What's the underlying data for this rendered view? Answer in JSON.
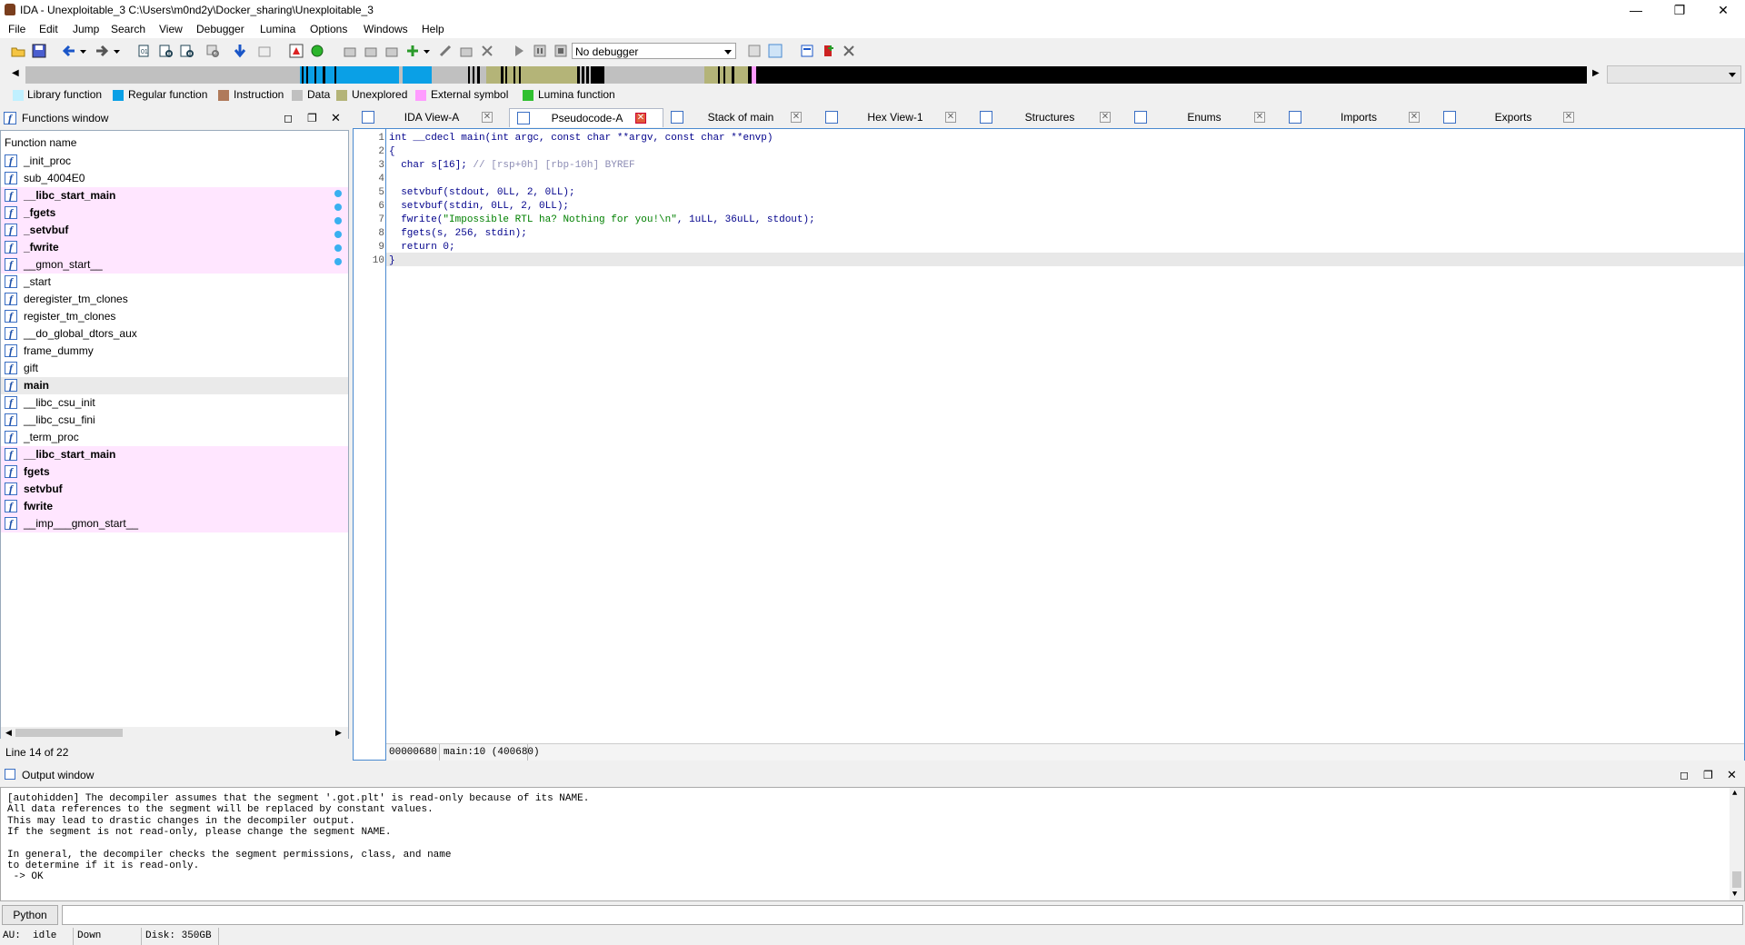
{
  "title_bar": {
    "title": "IDA - Unexploitable_3 C:\\Users\\m0nd2y\\Docker_sharing\\Unexploitable_3",
    "minimize": "—",
    "restore": "❐",
    "close": "✕"
  },
  "menu": [
    "File",
    "Edit",
    "Jump",
    "Search",
    "View",
    "Debugger",
    "Lumina",
    "Options",
    "Windows",
    "Help"
  ],
  "toolbar": {
    "debugger_select": "No debugger"
  },
  "legend": [
    {
      "label": "Library function",
      "color": "#c0f0ff"
    },
    {
      "label": "Regular function",
      "color": "#0aa0e6"
    },
    {
      "label": "Instruction",
      "color": "#b07a5a"
    },
    {
      "label": "Data",
      "color": "#c0c0c0"
    },
    {
      "label": "Unexplored",
      "color": "#b4b478"
    },
    {
      "label": "External symbol",
      "color": "#ff9cff"
    },
    {
      "label": "Lumina function",
      "color": "#30c030"
    }
  ],
  "functions_window": {
    "title": "Functions window",
    "column_header": "Function name",
    "status": "Line 14 of 22",
    "items": [
      {
        "name": "_init_proc",
        "style": "normal"
      },
      {
        "name": "sub_4004E0",
        "style": "normal"
      },
      {
        "name": "__libc_start_main",
        "style": "pink-bold"
      },
      {
        "name": "_fgets",
        "style": "pink-bold"
      },
      {
        "name": "_setvbuf",
        "style": "pink-bold"
      },
      {
        "name": "_fwrite",
        "style": "pink-bold"
      },
      {
        "name": "__gmon_start__",
        "style": "pink"
      },
      {
        "name": "_start",
        "style": "normal"
      },
      {
        "name": "deregister_tm_clones",
        "style": "normal"
      },
      {
        "name": "register_tm_clones",
        "style": "normal"
      },
      {
        "name": "__do_global_dtors_aux",
        "style": "normal"
      },
      {
        "name": "frame_dummy",
        "style": "normal"
      },
      {
        "name": "gift",
        "style": "normal"
      },
      {
        "name": "main",
        "style": "selected-bold"
      },
      {
        "name": "__libc_csu_init",
        "style": "normal"
      },
      {
        "name": "__libc_csu_fini",
        "style": "normal"
      },
      {
        "name": "_term_proc",
        "style": "normal"
      },
      {
        "name": "__libc_start_main",
        "style": "pink-bold"
      },
      {
        "name": "fgets",
        "style": "pink-bold"
      },
      {
        "name": "setvbuf",
        "style": "pink-bold"
      },
      {
        "name": "fwrite",
        "style": "pink-bold"
      },
      {
        "name": "__imp___gmon_start__",
        "style": "pink"
      }
    ]
  },
  "tabs": [
    {
      "label": "IDA View-A",
      "icon": "ida-view-icon",
      "active": false
    },
    {
      "label": "Pseudocode-A",
      "icon": "pseudocode-icon",
      "active": true
    },
    {
      "label": "Stack of main",
      "icon": "stack-icon",
      "active": false
    },
    {
      "label": "Hex View-1",
      "icon": "hex-view-icon",
      "active": false
    },
    {
      "label": "Structures",
      "icon": "structures-icon",
      "active": false
    },
    {
      "label": "Enums",
      "icon": "enums-icon",
      "active": false
    },
    {
      "label": "Imports",
      "icon": "imports-icon",
      "active": false
    },
    {
      "label": "Exports",
      "icon": "exports-icon",
      "active": false
    }
  ],
  "pseudocode": {
    "lines": [
      {
        "n": "1",
        "bp": false,
        "text": "int __cdecl main(int argc, const char **argv, const char **envp)"
      },
      {
        "n": "2",
        "bp": false,
        "text": "{"
      },
      {
        "n": "3",
        "bp": false,
        "text": "  char s[16]; ",
        "comment": "// [rsp+0h] [rbp-10h] BYREF"
      },
      {
        "n": "4",
        "bp": false,
        "text": ""
      },
      {
        "n": "5",
        "bp": true,
        "text": "  setvbuf(stdout, 0LL, 2, 0LL);"
      },
      {
        "n": "6",
        "bp": true,
        "text": "  setvbuf(stdin, 0LL, 2, 0LL);"
      },
      {
        "n": "7",
        "bp": true,
        "text": "  fwrite(",
        "string": "\"Impossible RTL ha? Nothing for you!\\n\"",
        "after": ", 1uLL, 36uLL, stdout);"
      },
      {
        "n": "8",
        "bp": true,
        "text": "  fgets(s, 256, stdin);"
      },
      {
        "n": "9",
        "bp": true,
        "text": "  return 0;"
      },
      {
        "n": "10",
        "bp": true,
        "text": "}"
      }
    ],
    "status_address": "00000680",
    "status_location": "main:10 (400680)"
  },
  "output_window": {
    "title": "Output window",
    "lines": [
      "[autohidden] The decompiler assumes that the segment '.got.plt' is read-only because of its NAME.",
      "All data references to the segment will be replaced by constant values.",
      "This may lead to drastic changes in the decompiler output.",
      "If the segment is not read-only, please change the segment NAME.",
      "",
      "In general, the decompiler checks the segment permissions, class, and name",
      "to determine if it is read-only.",
      " -> OK"
    ],
    "python_button": "Python"
  },
  "status_bar": {
    "au": "AU:",
    "au_state": "idle",
    "direction": "Down",
    "disk": "Disk: 350GB"
  }
}
